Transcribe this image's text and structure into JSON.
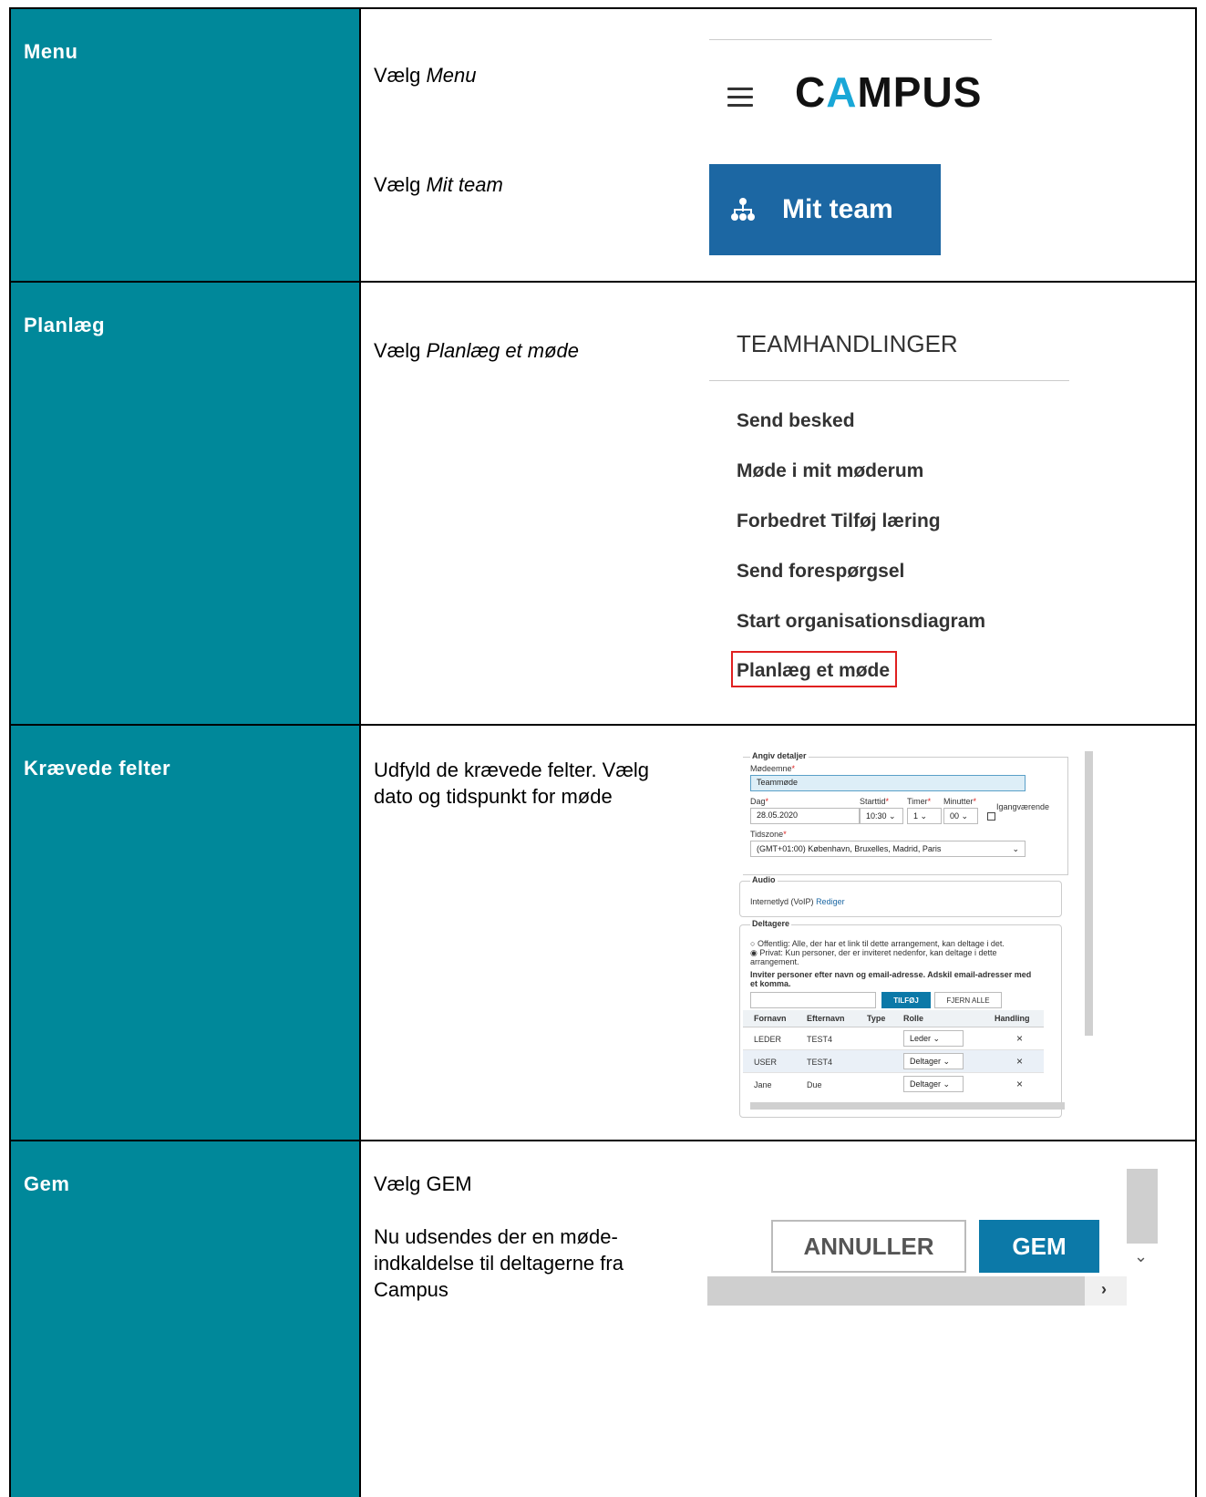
{
  "rows": [
    {
      "label": "Menu"
    },
    {
      "label": "Planlæg"
    },
    {
      "label": "Krævede felter"
    },
    {
      "label": "Gem"
    }
  ],
  "row1": {
    "inst1_prefix": "Vælg ",
    "inst1_em": "Menu",
    "inst2_prefix": "Vælg ",
    "inst2_em": "Mit team",
    "logo_left": "C",
    "logo_accent": "A",
    "logo_right": "MPUS",
    "mit_team_label": "Mit team"
  },
  "row2": {
    "inst_prefix": "Vælg ",
    "inst_em": "Planlæg et møde",
    "title": "TEAMHANDLINGER",
    "items": [
      "Send besked",
      "Møde i mit møderum",
      "Forbedret Tilføj læring",
      "Send forespørgsel",
      "Start organisationsdiagram",
      "Planlæg et møde"
    ]
  },
  "row3": {
    "instructions": "Udfyld de krævede felter. Vælg dato og tidspunkt for møde",
    "form": {
      "legend_details": "Angiv detaljer",
      "meeting_subject_label": "Mødeemne",
      "meeting_subject_value": "Teammøde",
      "day_label": "Dag",
      "day_value": "28.05.2020",
      "start_label": "Starttid",
      "start_value": "10:30",
      "hours_label": "Timer",
      "hours_value": "1",
      "minutes_label": "Minutter",
      "minutes_value": "00",
      "ongoing_label": "Igangværende",
      "timezone_label": "Tidszone",
      "timezone_value": "(GMT+01:00) København, Bruxelles, Madrid, Paris",
      "legend_audio": "Audio",
      "audio_value": "Internetlyd (VoIP)",
      "audio_edit": "Rediger",
      "legend_participants": "Deltagere",
      "public_option": "Offentlig: Alle, der har et link til dette arrangement, kan deltage i det.",
      "private_option": "Privat: Kun personer, der er inviteret nedenfor, kan deltage i dette arrangement.",
      "invite_text": "Inviter personer efter navn og email-adresse. Adskil email-adresser med et komma.",
      "add_button": "TILFØJ",
      "remove_all_button": "FJERN ALLE",
      "columns": [
        "Fornavn",
        "Efternavn",
        "Type",
        "Rolle",
        "Handling"
      ],
      "participants": [
        {
          "first": "LEDER",
          "last": "TEST4",
          "role": "Leder"
        },
        {
          "first": "USER",
          "last": "TEST4",
          "role": "Deltager"
        },
        {
          "first": "Jane",
          "last": "Due",
          "role": "Deltager"
        }
      ]
    }
  },
  "row4": {
    "inst1": "Vælg GEM",
    "inst2": "Nu udsendes der en møde-indkaldelse til deltagerne fra Campus",
    "cancel_button": "ANNULLER",
    "save_button": "GEM"
  },
  "colors": {
    "teal": "#00889a",
    "blue": "#1c67a3",
    "gem_blue": "#0c79a8",
    "highlight_red": "#e02020"
  }
}
